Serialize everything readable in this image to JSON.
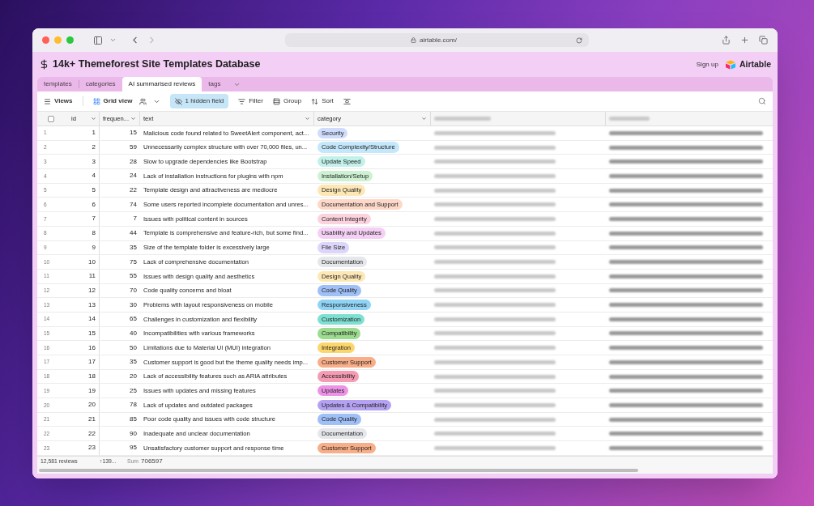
{
  "browser": {
    "url": "airtable.com/"
  },
  "base": {
    "title": "14k+ Themeforest Site Templates Database",
    "signup": "Sign up",
    "brand": "Airtable"
  },
  "tabs": [
    {
      "label": "templates",
      "selected": false
    },
    {
      "label": "categories",
      "selected": false
    },
    {
      "label": "AI summarised reviews",
      "selected": true
    },
    {
      "label": "tags",
      "selected": false
    }
  ],
  "toolbar": {
    "views": "Views",
    "grid_view": "Grid view",
    "hidden": "1 hidden field",
    "filter": "Filter",
    "group": "Group",
    "sort": "Sort"
  },
  "table": {
    "select_all": {
      "checked": false
    },
    "columns": [
      "id",
      "frequen...",
      "text",
      "category"
    ],
    "rows": [
      {
        "num": "1",
        "id": "1",
        "freq": "15",
        "text": "Malicious code found related to SweetAlert component, act...",
        "category": "Security",
        "color": "#cfdcfb"
      },
      {
        "num": "2",
        "id": "2",
        "freq": "59",
        "text": "Unnecessarily complex structure with over 70,000 files, un...",
        "category": "Code Complexity/Structure",
        "color": "#c4e7fb"
      },
      {
        "num": "3",
        "id": "3",
        "freq": "28",
        "text": "Slow to upgrade dependencies like Bootstrap",
        "category": "Update Speed",
        "color": "#c2f1ea"
      },
      {
        "num": "4",
        "id": "4",
        "freq": "24",
        "text": "Lack of installation instructions for plugins with npm",
        "category": "Installation/Setup",
        "color": "#cdf1d2"
      },
      {
        "num": "5",
        "id": "5",
        "freq": "22",
        "text": "Template design and attractiveness are mediocre",
        "category": "Design Quality",
        "color": "#fde7b5"
      },
      {
        "num": "6",
        "id": "6",
        "freq": "74",
        "text": "Some users reported incomplete documentation and unres...",
        "category": "Documentation and Support",
        "color": "#fdd8c8"
      },
      {
        "num": "7",
        "id": "7",
        "freq": "7",
        "text": "Issues with political content in sources",
        "category": "Content Integrity",
        "color": "#fbd2dd"
      },
      {
        "num": "8",
        "id": "8",
        "freq": "44",
        "text": "Template is comprehensive and feature-rich, but some find...",
        "category": "Usability and Updates",
        "color": "#f5d0f5"
      },
      {
        "num": "9",
        "id": "9",
        "freq": "35",
        "text": "Size of the template folder is excessively large",
        "category": "File Size",
        "color": "#ddd6fa"
      },
      {
        "num": "10",
        "id": "10",
        "freq": "75",
        "text": "Lack of comprehensive documentation",
        "category": "Documentation",
        "color": "#e5e7eb"
      },
      {
        "num": "11",
        "id": "11",
        "freq": "55",
        "text": "Issues with design quality and aesthetics",
        "category": "Design Quality",
        "color": "#fde7b5"
      },
      {
        "num": "12",
        "id": "12",
        "freq": "70",
        "text": "Code quality concerns and bloat",
        "category": "Code Quality",
        "color": "#9fbff7"
      },
      {
        "num": "13",
        "id": "13",
        "freq": "30",
        "text": "Problems with layout responsiveness on mobile",
        "category": "Responsiveness",
        "color": "#8fd3f5"
      },
      {
        "num": "14",
        "id": "14",
        "freq": "65",
        "text": "Challenges in customization and flexibility",
        "category": "Customization",
        "color": "#7ee0d3"
      },
      {
        "num": "15",
        "id": "15",
        "freq": "40",
        "text": "Incompatibilities with various frameworks",
        "category": "Compatibility",
        "color": "#9bdc8f"
      },
      {
        "num": "16",
        "id": "16",
        "freq": "50",
        "text": "Limitations due to Material UI (MUI) integration",
        "category": "Integration",
        "color": "#fcd66b"
      },
      {
        "num": "17",
        "id": "17",
        "freq": "35",
        "text": "Customer support is good but the theme quality needs imp...",
        "category": "Customer Support",
        "color": "#f8ae88"
      },
      {
        "num": "18",
        "id": "18",
        "freq": "20",
        "text": "Lack of accessibility features such as ARIA attributes",
        "category": "Accessibility",
        "color": "#f59bb3"
      },
      {
        "num": "19",
        "id": "19",
        "freq": "25",
        "text": "Issues with updates and missing features",
        "category": "Updates",
        "color": "#ec93e6"
      },
      {
        "num": "20",
        "id": "20",
        "freq": "78",
        "text": "Lack of updates and outdated packages",
        "category": "Updates & Compatibility",
        "color": "#b5a1f2"
      },
      {
        "num": "21",
        "id": "21",
        "freq": "85",
        "text": "Poor code quality and issues with code structure",
        "category": "Code Quality",
        "color": "#9fbff7"
      },
      {
        "num": "22",
        "id": "22",
        "freq": "90",
        "text": "Inadequate and unclear documentation",
        "category": "Documentation",
        "color": "#e5e7eb"
      },
      {
        "num": "23",
        "id": "23",
        "freq": "95",
        "text": "Unsatisfactory customer support and response time",
        "category": "Customer Support",
        "color": "#f8ae88"
      }
    ]
  },
  "footer": {
    "count": "12,581 reviews",
    "col_summary": "↑139...",
    "sum_label": "Sum",
    "sum": "706597"
  }
}
